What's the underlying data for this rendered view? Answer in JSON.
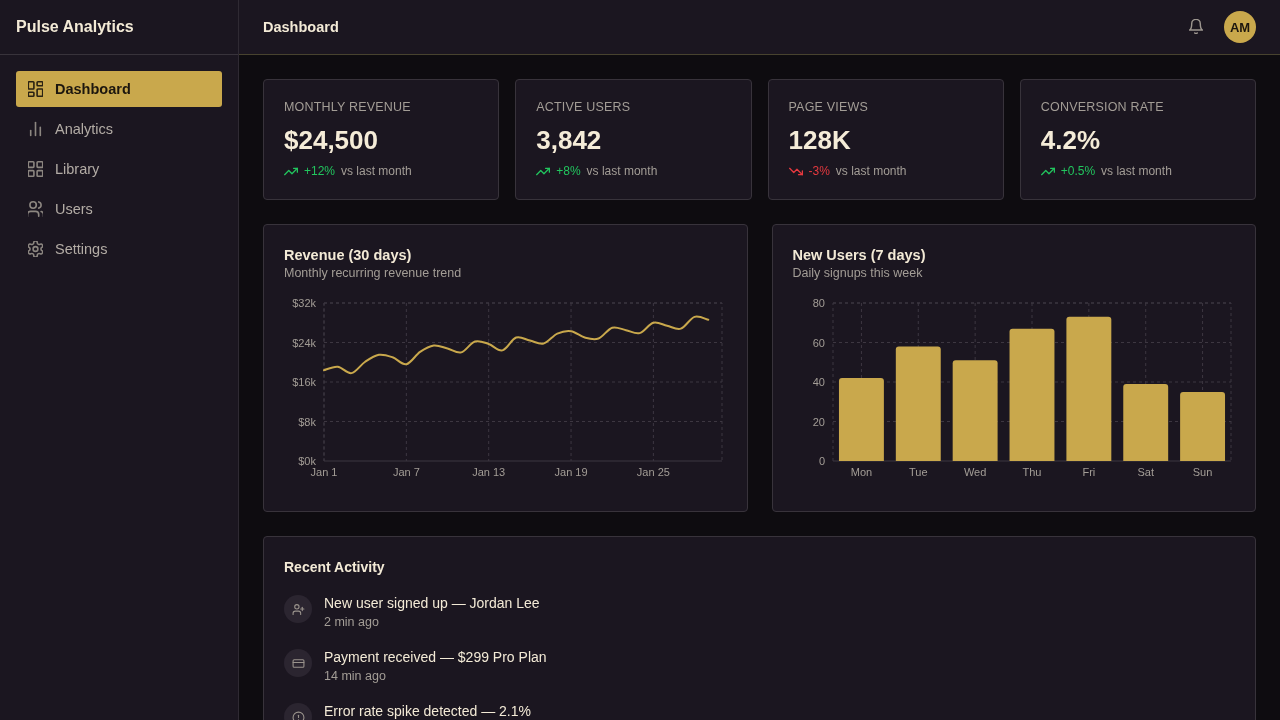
{
  "sidebar": {
    "brand": "Pulse Analytics",
    "items": [
      {
        "label": "Dashboard",
        "kind": "dashboard",
        "selected": true
      },
      {
        "label": "Analytics",
        "kind": "analytics",
        "selected": false
      },
      {
        "label": "Library",
        "kind": "library",
        "selected": false
      },
      {
        "label": "Users",
        "kind": "users",
        "selected": false
      },
      {
        "label": "Settings",
        "kind": "settings",
        "selected": false
      }
    ]
  },
  "header": {
    "title": "Dashboard",
    "avatar": "AM"
  },
  "stats": [
    {
      "label": "MONTHLY REVENUE",
      "value": "$24,500",
      "change": "+12%",
      "positive": true,
      "note": "vs last month"
    },
    {
      "label": "ACTIVE USERS",
      "value": "3,842",
      "change": "+8%",
      "positive": true,
      "note": "vs last month"
    },
    {
      "label": "PAGE VIEWS",
      "value": "128K",
      "change": "-3%",
      "positive": false,
      "note": "vs last month"
    },
    {
      "label": "CONVERSION RATE",
      "value": "4.2%",
      "change": "+0.5%",
      "positive": true,
      "note": "vs last month"
    }
  ],
  "charts": [
    {
      "title": "Revenue (30 days)",
      "subtitle": "Monthly recurring revenue trend",
      "chart_data": {
        "type": "line",
        "grid": true,
        "categories": [
          "Jan 1",
          null,
          null,
          null,
          null,
          null,
          "Jan 7",
          null,
          null,
          null,
          null,
          null,
          "Jan 13",
          null,
          null,
          null,
          null,
          null,
          "Jan 19",
          null,
          null,
          null,
          null,
          null,
          "Jan 25",
          null,
          null,
          null,
          null
        ],
        "ylim": [
          0,
          32000
        ],
        "yticks": [
          {
            "value": 0,
            "label": "$0k"
          },
          {
            "value": 8000,
            "label": "$8k"
          },
          {
            "value": 16000,
            "label": "$16k"
          },
          {
            "value": 24000,
            "label": "$24k"
          },
          {
            "value": 32000,
            "label": "$32k"
          }
        ],
        "series": [
          {
            "color": "#c9a84c",
            "values": [
              18400,
              19100,
              17800,
              20100,
              21500,
              21000,
              19600,
              22100,
              23400,
              22800,
              22000,
              24200,
              23700,
              22400,
              25000,
              24400,
              23800,
              25800,
              26300,
              25000,
              24800,
              27000,
              26500,
              25900,
              28000,
              27400,
              26800,
              29200,
              28600
            ]
          }
        ]
      }
    },
    {
      "title": "New Users (7 days)",
      "subtitle": "Daily signups this week",
      "chart_data": {
        "type": "bar",
        "grid": true,
        "categories": [
          "Mon",
          "Tue",
          "Wed",
          "Thu",
          "Fri",
          "Sat",
          "Sun"
        ],
        "values": [
          42,
          58,
          51,
          67,
          73,
          39,
          35
        ],
        "ylim": [
          0,
          80
        ],
        "yticks": [
          0,
          20,
          40,
          60,
          80
        ]
      }
    }
  ],
  "activity": {
    "title": "Recent Activity",
    "items": [
      {
        "kind": "signup",
        "text": "New user signed up — Jordan Lee",
        "time": "2 min ago"
      },
      {
        "kind": "payment",
        "text": "Payment received — $299 Pro Plan",
        "time": "14 min ago"
      },
      {
        "kind": "alert",
        "text": "Error rate spike detected — 2.1%"
      }
    ]
  }
}
